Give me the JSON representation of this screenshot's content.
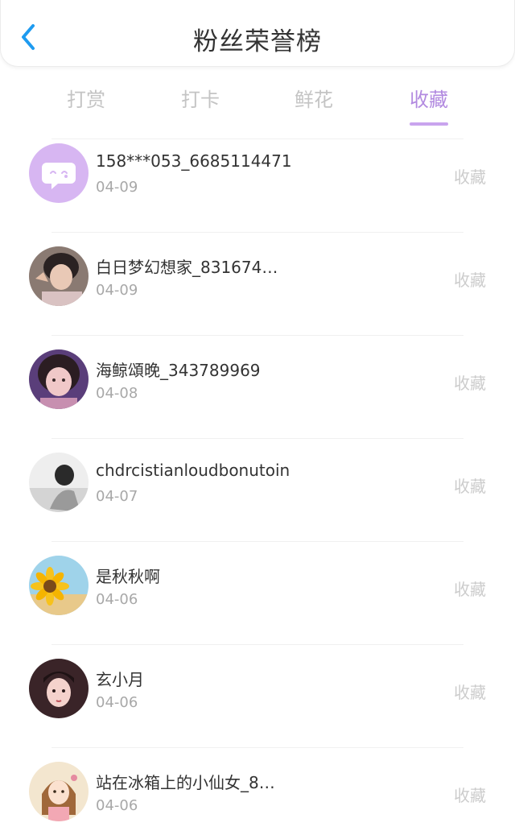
{
  "header": {
    "title": "粉丝荣誉榜",
    "back_icon": "chevron-left-icon",
    "back_color": "#1e9bf0"
  },
  "tabs": [
    {
      "label": "打赏",
      "active": false
    },
    {
      "label": "打卡",
      "active": false
    },
    {
      "label": "鲜花",
      "active": false
    },
    {
      "label": "收藏",
      "active": true
    }
  ],
  "accent_color": "#b28ae0",
  "fans": [
    {
      "name": "158***053_6685114471",
      "date": "04-09",
      "action": "收藏",
      "avatar": "default-chat-avatar"
    },
    {
      "name": "白日梦幻想家_831674…",
      "date": "04-09",
      "action": "收藏",
      "avatar": "user-photo-avatar"
    },
    {
      "name": "海鲸頌晚_343789969",
      "date": "04-08",
      "action": "收藏",
      "avatar": "user-photo-avatar"
    },
    {
      "name": "chdrcistianloudbonutoin",
      "date": "04-07",
      "action": "收藏",
      "avatar": "user-photo-avatar"
    },
    {
      "name": "是秋秋啊",
      "date": "04-06",
      "action": "收藏",
      "avatar": "sunflower-avatar"
    },
    {
      "name": "玄小月",
      "date": "04-06",
      "action": "收藏",
      "avatar": "illustrated-girl-avatar"
    },
    {
      "name": "站在冰箱上的小仙女_8…",
      "date": "04-06",
      "action": "收藏",
      "avatar": "illustrated-girl-avatar"
    }
  ]
}
